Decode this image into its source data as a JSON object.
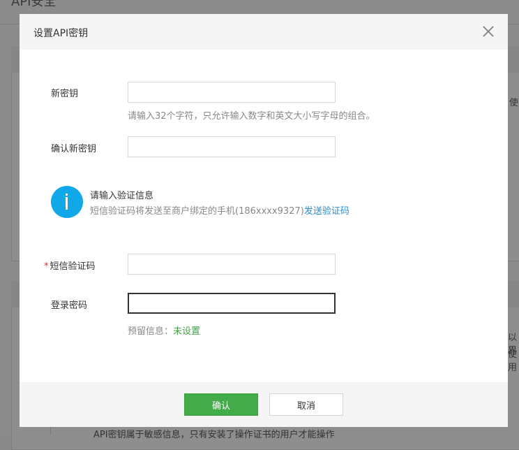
{
  "background": {
    "page_title": "API安全",
    "side_text_1": "使",
    "side_text_2": "以界",
    "side_text_3": "使用",
    "bottom_text": "API密钥属于敏感信息，只有安装了操作证书的用户才能操作"
  },
  "dialog": {
    "title": "设置API密钥",
    "close_icon": "close-icon",
    "new_key": {
      "label": "新密钥",
      "value": "",
      "hint": "请输入32个字符，只允许输入数字和英文大小写字母的组合。"
    },
    "confirm_key": {
      "label": "确认新密钥",
      "value": ""
    },
    "info": {
      "icon": "info-icon",
      "title": "请输入验证信息",
      "text": "短信验证码将发送至商户绑定的手机(186xxxx9327)",
      "link": "发送验证码",
      "color": "#10a8e8"
    },
    "sms_code": {
      "required_mark": "*",
      "label": "短信验证码",
      "value": ""
    },
    "login_password": {
      "label": "登录密码",
      "value": "",
      "reserved_label": "预留信息：",
      "reserved_value": "未设置"
    },
    "buttons": {
      "confirm": "确认",
      "cancel": "取消"
    },
    "colors": {
      "primary": "#44ab4b",
      "link": "#2b8cd6"
    }
  }
}
